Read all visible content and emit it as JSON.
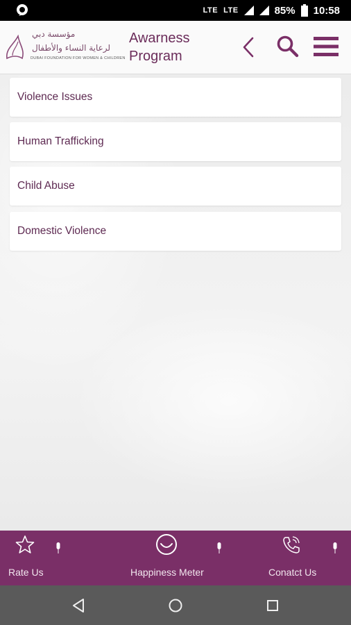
{
  "status_bar": {
    "network_1": "LTE",
    "network_2": "LTE",
    "battery": "85%",
    "time": "10:58"
  },
  "header": {
    "logo_arabic_line1": "مؤسسة دبي",
    "logo_arabic_line2": "لرعاية النساء والأطفال",
    "logo_english": "DUBAI FOUNDATION FOR WOMEN & CHILDREN",
    "title_line1": "Awarness",
    "title_line2": "Program",
    "icons": [
      "back-chevron-icon",
      "search-icon",
      "hamburger-menu-icon"
    ]
  },
  "list": {
    "items": [
      {
        "label": "Violence Issues"
      },
      {
        "label": "Human Trafficking"
      },
      {
        "label": "Child Abuse"
      },
      {
        "label": "Domestic Violence"
      }
    ]
  },
  "bottom_bar": {
    "tabs": [
      {
        "label": "Rate Us",
        "icon": "star-icon"
      },
      {
        "label": "Happiness Meter",
        "icon": "smiley-icon"
      },
      {
        "label": "Conatct Us",
        "icon": "phone-icon"
      }
    ]
  },
  "colors": {
    "brand": "#7a2f67",
    "title_text": "#6b2c5a",
    "list_text": "#5e2a52"
  }
}
